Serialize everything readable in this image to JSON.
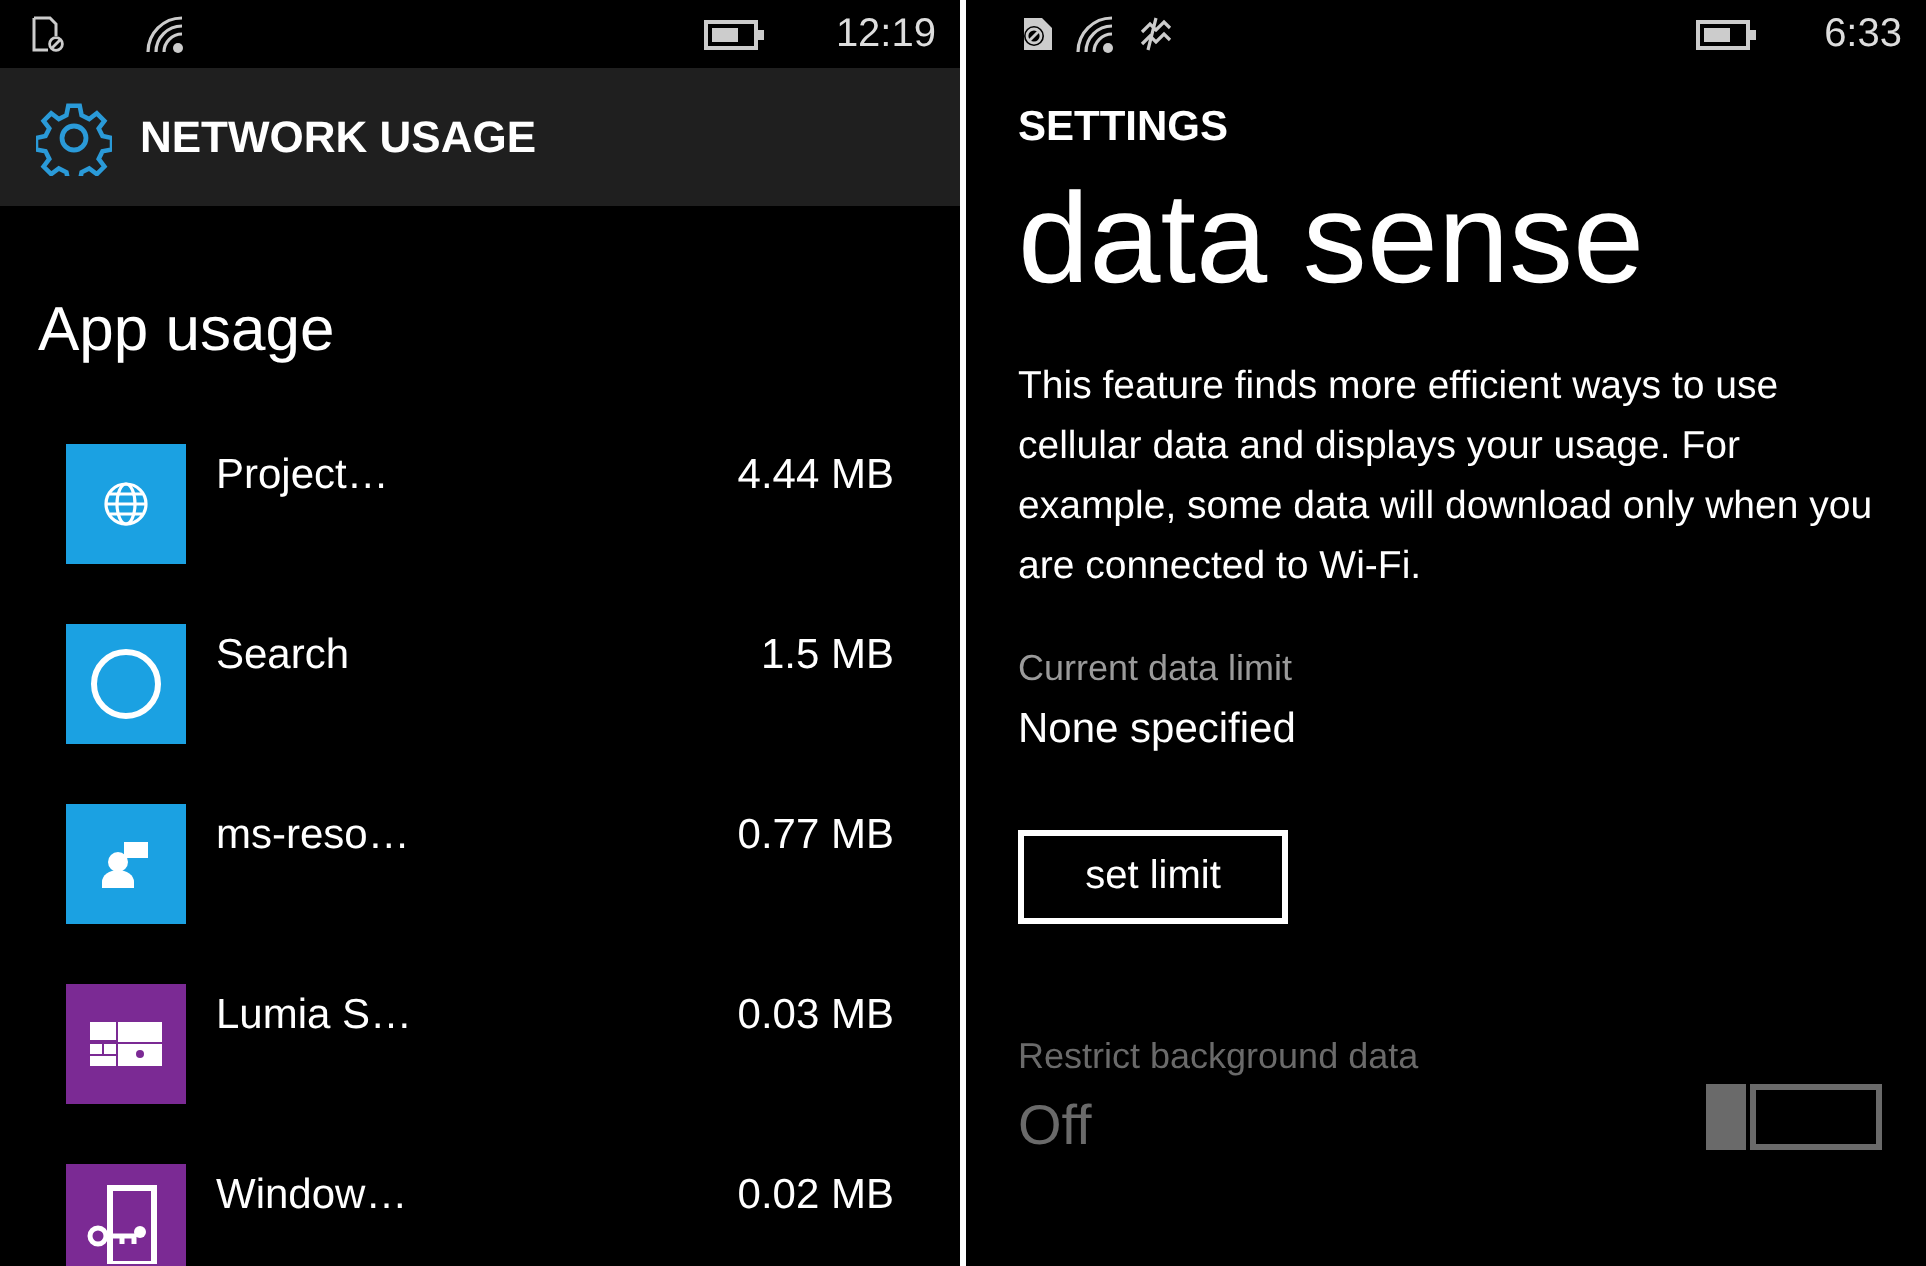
{
  "left": {
    "status": {
      "time": "12:19"
    },
    "header": {
      "title": "NETWORK USAGE"
    },
    "heading": "App usage",
    "apps": [
      {
        "name": "Project…",
        "usage": "4.44 MB",
        "color": "#1ba1e2",
        "kind": "globe"
      },
      {
        "name": "Search",
        "usage": "1.5 MB",
        "color": "#1ba1e2",
        "kind": "ring"
      },
      {
        "name": "ms-reso…",
        "usage": "0.77 MB",
        "color": "#1ba1e2",
        "kind": "contact"
      },
      {
        "name": "Lumia S…",
        "usage": "0.03 MB",
        "color": "#7b2a94",
        "kind": "tiles"
      },
      {
        "name": "Window…",
        "usage": "0.02 MB",
        "color": "#7b2a94",
        "kind": "key"
      }
    ]
  },
  "right": {
    "status": {
      "time": "6:33"
    },
    "section": "SETTINGS",
    "title": "data sense",
    "description": "This feature finds more efficient ways to use cellular data and displays your usage. For example, some data will download only when you are connected to Wi-Fi.",
    "limit": {
      "label": "Current data limit",
      "value": "None specified"
    },
    "button": "set limit",
    "restrict": {
      "label": "Restrict background data",
      "value": "Off",
      "on": false,
      "disabled": true
    }
  }
}
